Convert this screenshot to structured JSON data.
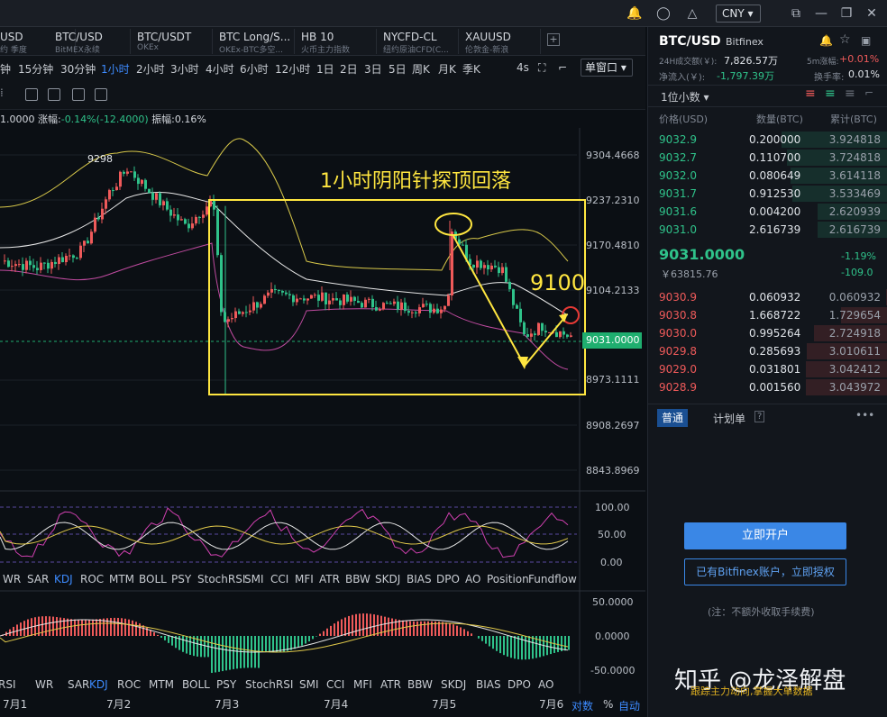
{
  "topbar": {
    "currency": "CNY",
    "icons": [
      "bell-icon",
      "search-icon",
      "shirt-icon",
      "share-icon",
      "minimize-icon",
      "restore-icon",
      "close-icon"
    ]
  },
  "tabs": [
    {
      "title": "USD",
      "sub": "约 季度"
    },
    {
      "title": "BTC/USD",
      "sub": "BitMEX永续"
    },
    {
      "title": "BTC/USDT",
      "sub": "OKEx"
    },
    {
      "title": "BTC Long/S...",
      "sub": "OKEx-BTC多空..."
    },
    {
      "title": "HB 10",
      "sub": "火币主力指数"
    },
    {
      "title": "NYCFD-CL",
      "sub": "纽约原油CFD(C..."
    },
    {
      "title": "XAUUSD",
      "sub": "伦敦金-新浪"
    }
  ],
  "intervals": [
    "钟",
    "15分钟",
    "30分钟",
    "1小时",
    "2小时",
    "3小时",
    "4小时",
    "6小时",
    "12小时",
    "1日",
    "2日",
    "3日",
    "5日",
    "周K",
    "月K",
    "季K"
  ],
  "active_interval": "1小时",
  "refresh": "4s",
  "window_mode": "单窗口",
  "info": {
    "price": "1.0000",
    "change_label": "涨幅:",
    "change": "-0.14%(-12.4000)",
    "amp_label": "振幅:",
    "amp": "0.16%"
  },
  "annotations": {
    "title": "1小时阴阳针探顶回落",
    "level": "9100",
    "high_label": "9298"
  },
  "price_axis": [
    "9304.4668",
    "9237.2310",
    "9170.4810",
    "9104.2133",
    "9031.0000",
    "8973.1111",
    "8908.2697",
    "8843.8969"
  ],
  "current_price_tag": "9031.0000",
  "osc_axis": [
    "100.00",
    "50.00",
    "0.00"
  ],
  "macd_axis": [
    "50.0000",
    "0.0000",
    "-50.0000"
  ],
  "indicators_1": [
    "WR",
    "SAR",
    "KDJ",
    "ROC",
    "MTM",
    "BOLL",
    "PSY",
    "StochRSI",
    "SMI",
    "CCI",
    "MFI",
    "ATR",
    "BBW",
    "SKDJ",
    "BIAS",
    "DPO",
    "AO",
    "Position",
    "Fundflow"
  ],
  "indicators_2": [
    "RSI",
    "WR",
    "SAR",
    "KDJ",
    "ROC",
    "MTM",
    "BOLL",
    "PSY",
    "StochRSI",
    "SMI",
    "CCI",
    "MFI",
    "ATR",
    "BBW",
    "SKDJ",
    "BIAS",
    "DPO",
    "AO"
  ],
  "dates": [
    "7月1",
    "7月2",
    "7月3",
    "7月4",
    "7月5",
    "7月6"
  ],
  "bottom_right": {
    "log": "对数",
    "pct": "%",
    "auto": "自动"
  },
  "watermark": "知乎 @龙泽解盘",
  "watermark_sub": "跟踪主力动向,掌握大单数据",
  "panel": {
    "pair": "BTC/USD",
    "exchange": "Bitfinex",
    "vol_label": "24H成交额(￥):",
    "vol": "7,826.57万",
    "rise_label": "5m涨幅:",
    "rise": "+0.01%",
    "inflow_label": "净流入(￥):",
    "inflow": "-1,797.39万",
    "turnover_label": "换手率:",
    "turnover": "0.01%",
    "decimals": "1位小数",
    "headers": [
      "价格(USD)",
      "数量(BTC)",
      "累计(BTC)"
    ],
    "asks": [
      {
        "p": "9032.9",
        "q": "0.200000",
        "c": "3.924818",
        "d": 0.98
      },
      {
        "p": "9032.7",
        "q": "0.110700",
        "c": "3.724818",
        "d": 0.93
      },
      {
        "p": "9032.0",
        "q": "0.080649",
        "c": "3.614118",
        "d": 0.9
      },
      {
        "p": "9031.7",
        "q": "0.912530",
        "c": "3.533469",
        "d": 0.88
      },
      {
        "p": "9031.6",
        "q": "0.004200",
        "c": "2.620939",
        "d": 0.65
      },
      {
        "p": "9031.0",
        "q": "2.616739",
        "c": "2.616739",
        "d": 0.65
      }
    ],
    "last_price": "9031.0000",
    "last_pct": "-1.19%",
    "cny_price": "￥63815.76",
    "last_chg": "-109.0",
    "bids": [
      {
        "p": "9030.9",
        "q": "0.060932",
        "c": "0.060932",
        "d": 0.02
      },
      {
        "p": "9030.8",
        "q": "1.668722",
        "c": "1.729654",
        "d": 0.43
      },
      {
        "p": "9030.0",
        "q": "0.995264",
        "c": "2.724918",
        "d": 0.68
      },
      {
        "p": "9029.8",
        "q": "0.285693",
        "c": "3.010611",
        "d": 0.75
      },
      {
        "p": "9029.0",
        "q": "0.031801",
        "c": "3.042412",
        "d": 0.76
      },
      {
        "p": "9028.9",
        "q": "0.001560",
        "c": "3.043972",
        "d": 0.76
      }
    ],
    "tab_normal": "普通",
    "tab_plan": "计划单",
    "open_btn": "立即开户",
    "auth_btn": "已有Bitfinex账户，立即授权",
    "note": "(注：不额外收取手续费)"
  }
}
